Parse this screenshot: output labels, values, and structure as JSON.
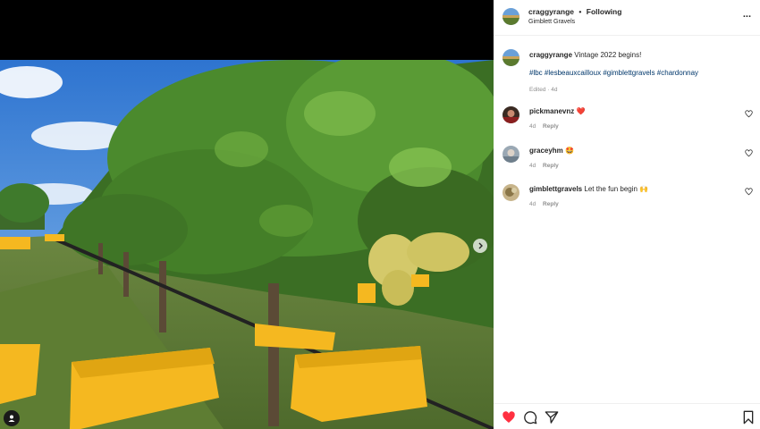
{
  "post": {
    "username": "craggyrange",
    "follow_label": "Following",
    "separator": "•",
    "location": "Gimblett Gravels",
    "more_label": "...",
    "caption": "Vintage 2022 begins!",
    "hashtags": [
      "#lbc",
      "#lesbeauxcailloux",
      "#gimblettgravels",
      "#chardonnay"
    ],
    "edited": "Edited · 4d"
  },
  "comments": [
    {
      "user": "pickmanevnz",
      "text": "",
      "emoji": "❤️",
      "age": "4d",
      "reply_label": "Reply"
    },
    {
      "user": "graceyhm",
      "text": "",
      "emoji": "🤩",
      "age": "4d",
      "reply_label": "Reply"
    },
    {
      "user": "gimblettgravels",
      "text": "Let the fun begin",
      "emoji": "🙌",
      "age": "4d",
      "reply_label": "Reply"
    }
  ],
  "colors": {
    "accent_like": "#ff3040",
    "hashtag": "#00376b",
    "muted": "#8e8e8e",
    "crate_yellow": "#f5b820",
    "sky": "#3f86d8"
  },
  "icons": {
    "like": "heart-filled-icon",
    "comment": "comment-bubble-icon",
    "share": "paper-plane-icon",
    "save": "bookmark-icon",
    "next": "chevron-right-icon",
    "tags": "person-tag-icon"
  }
}
